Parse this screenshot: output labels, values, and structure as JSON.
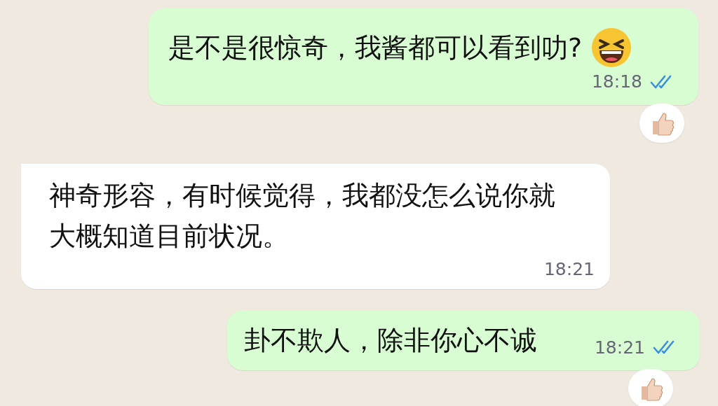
{
  "messages": [
    {
      "kind": "outgoing",
      "text": "是不是很惊奇，我酱都可以看到叻?",
      "emoji_after": true,
      "time": "18:18",
      "read": true,
      "reaction": true
    },
    {
      "kind": "incoming",
      "text": "神奇形容，有时候觉得，我都没怎么说你就大概知道目前状况。",
      "emoji_after": false,
      "time": "18:21",
      "reaction": false
    },
    {
      "kind": "outgoing",
      "text": "卦不欺人，除非你心不诚",
      "emoji_after": false,
      "time": "18:21",
      "read": true,
      "reaction": true
    }
  ]
}
